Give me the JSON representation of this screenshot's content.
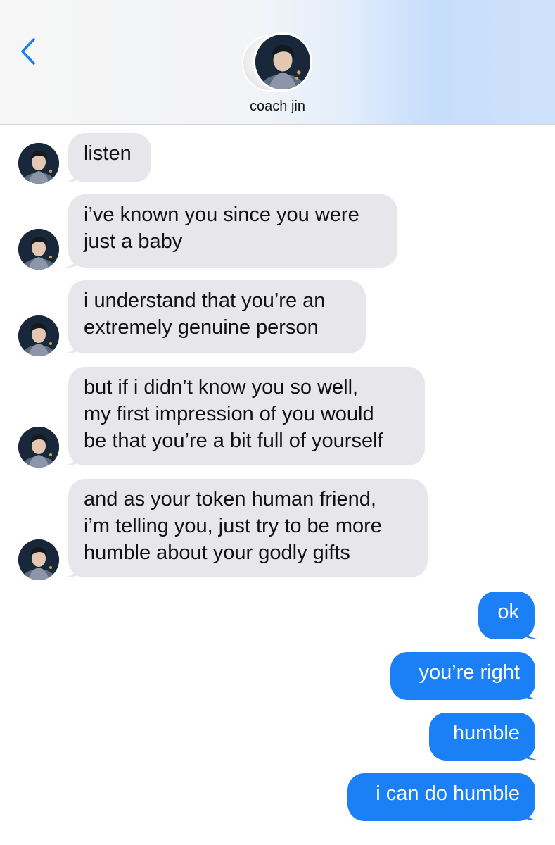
{
  "header": {
    "contact_name": "coach jin",
    "back_icon": "chevron-left-icon",
    "accent_color": "#1b80f6"
  },
  "messages": [
    {
      "from": "them",
      "lines": [
        "listen"
      ]
    },
    {
      "from": "them",
      "lines": [
        "i’ve known you since you were",
        "just a baby"
      ]
    },
    {
      "from": "them",
      "lines": [
        "i understand that you’re an",
        "extremely genuine person"
      ]
    },
    {
      "from": "them",
      "lines": [
        "but if i didn’t know you so well,",
        "my first impression of you would",
        "be that you’re a bit full of yourself"
      ]
    },
    {
      "from": "them",
      "lines": [
        "and as your token human friend,",
        "i’m telling you, just try to be more",
        "humble about your godly gifts"
      ]
    },
    {
      "from": "me",
      "lines": [
        "ok"
      ]
    },
    {
      "from": "me",
      "lines": [
        "you’re right"
      ]
    },
    {
      "from": "me",
      "lines": [
        "humble"
      ]
    },
    {
      "from": "me",
      "lines": [
        "i can do humble"
      ]
    }
  ],
  "colors": {
    "incoming_bubble": "#e6e6eb",
    "outgoing_bubble": "#1b80f6",
    "incoming_text": "#111111",
    "outgoing_text": "#ffffff"
  }
}
